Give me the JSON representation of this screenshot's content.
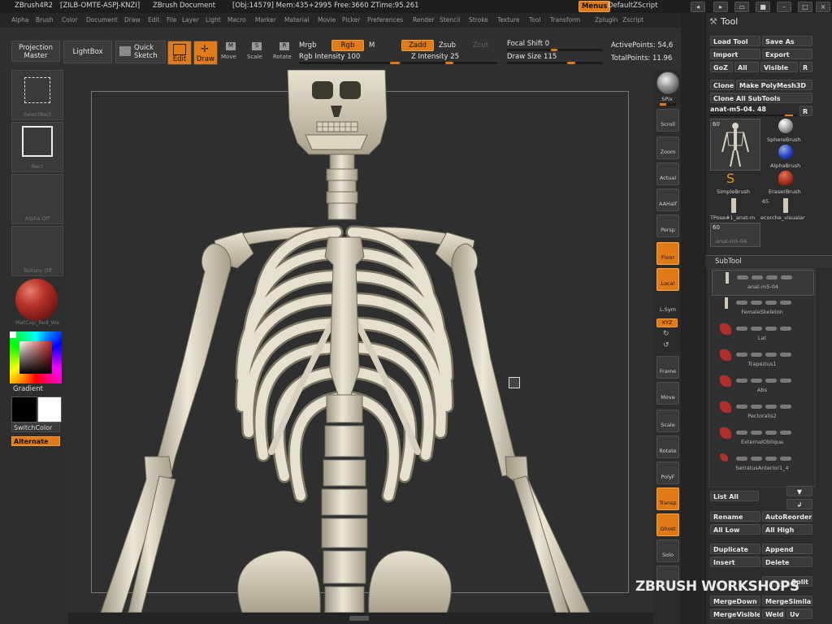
{
  "titlebar": {
    "app": "ZBrush4R2",
    "doc_id": "[ZILB-OMTE-ASPJ-KNZI]",
    "doc": "ZBrush Document",
    "stats": "[Obj:14579] Mem:435+2995 Free:3660 ZTime:95.261",
    "menus_label": "Menus",
    "script_label": "DefaultZScript"
  },
  "menubar": [
    "Alpha",
    "Brush",
    "Color",
    "Document",
    "Draw",
    "Edit",
    "File",
    "Layer",
    "Light",
    "Macro",
    "Marker",
    "Material",
    "Movie",
    "Picker",
    "Preferences",
    "Render",
    "Stencil",
    "Stroke",
    "Texture",
    "Tool",
    "Transform",
    "Zplugin",
    "Zscript"
  ],
  "shelf": {
    "projection_master": "Projection Master",
    "lightbox": "LightBox",
    "quick_sketch": "Quick Sketch",
    "edit": "Edit",
    "draw": "Draw",
    "move": "Move",
    "scale": "Scale",
    "rotate": "Rotate",
    "mrgb": "Mrgb",
    "rgb": "Rgb",
    "m": "M",
    "zadd": "Zadd",
    "zsub": "Zsub",
    "zcut": "Zcut",
    "rgb_intensity": "Rgb Intensity 100",
    "z_intensity": "Z Intensity 25",
    "focal_shift": "Focal Shift 0",
    "draw_size": "Draw Size 115",
    "active_points": "ActivePoints: 54,6",
    "total_points": "TotalPoints: 11.96",
    "rgb_intensity_value": 100,
    "z_intensity_value": 25,
    "draw_size_value": 115
  },
  "left": {
    "select_rect": "SelectRect",
    "rect": "Rect",
    "alpha_off": "Alpha Off",
    "texture_off": "Texture Off",
    "matcap": "MatCap_Red_Wa",
    "gradient": "Gradient",
    "switch_color": "SwitchColor",
    "alternate": "Alternate"
  },
  "right": {
    "bpr": "BPR",
    "spix": "SPix",
    "scroll": "Scroll",
    "zoom": "Zoom",
    "actual": "Actual",
    "aahalf": "AAHalf",
    "persp": "Persp",
    "floor": "Floor",
    "local": "Local",
    "lsym": "L.Sym",
    "xyz": "XYZ",
    "frame": "Frame",
    "move": "Move",
    "scale": "Scale",
    "rotate": "Rotate",
    "polyf": "PolyF",
    "transp": "Transp",
    "ghost": "Ghost",
    "solo": "Solo"
  },
  "tool": {
    "title": "Tool",
    "load_tool": "Load Tool",
    "save_as": "Save As",
    "import": "Import",
    "export": "Export",
    "goz": "GoZ",
    "all": "All",
    "visible": "Visible",
    "r": "R",
    "clone": "Clone",
    "make_polymesh": "Make PolyMesh3D",
    "clone_all": "Clone All SubTools",
    "current_tool": "anat-m5-04. 48",
    "thumb_count": "60",
    "thumbs": [
      "SphereBrush",
      "AlphaBrush",
      "SimpleBrush",
      "EraserBrush"
    ],
    "tpose": "TPose#1_anat-m",
    "ecorche": "ecorche_visualar",
    "ecorche_count": "65",
    "small_count": "60",
    "small_name": "anat-m5-04"
  },
  "subtool": {
    "title": "SubTool",
    "items": [
      "anat-m5-04",
      "FemaleSkeleton",
      "Lat",
      "Trapezius1",
      "Abs",
      "Pectoralis2",
      "ExternalOblique",
      "SerratusAnterior1_4"
    ],
    "list_all": "List All",
    "rename": "Rename",
    "auto_reorder": "AutoReorder",
    "all_low": "All Low",
    "all_high": "All High",
    "duplicate": "Duplicate",
    "append": "Append",
    "insert": "Insert",
    "delete": "Delete",
    "split": "Split",
    "merge_down": "MergeDown",
    "merge_similar": "MergeSimilar",
    "merge_visible": "MergeVisible",
    "weld": "Weld",
    "uv": "Uv"
  },
  "watermark": "ZBRUSH WORKSHOPS",
  "colors": {
    "accent": "#e07b18",
    "bone": "#e2dccb",
    "panel": "#2c2c2c"
  }
}
